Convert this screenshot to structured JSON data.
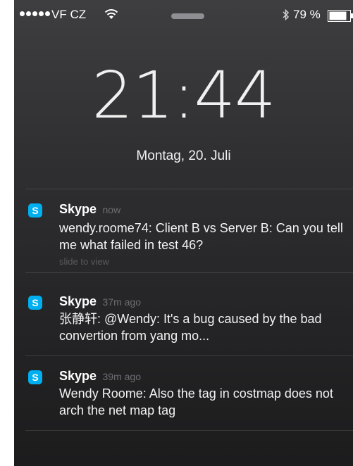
{
  "status_bar": {
    "carrier": "VF CZ",
    "battery": "79 %"
  },
  "lockscreen": {
    "time": "21:44",
    "date": "Montag, 20. Juli"
  },
  "notifications": [
    {
      "app": "Skype",
      "time": "now",
      "message": "wendy.roome74: Client B vs Server B: Can you tell me what failed in test 46?",
      "hint": "slide to view"
    },
    {
      "app": "Skype",
      "time": "37m ago",
      "message": "张静轩: @Wendy: It's a bug caused by the bad convertion from  yang mo..."
    },
    {
      "app": "Skype",
      "time": "39m ago",
      "message": "Wendy Roome: Also the tag in costmap does not arch the net map tag"
    }
  ],
  "colors": {
    "skype_blue": "#00aff0",
    "background": "#2f2f31"
  }
}
